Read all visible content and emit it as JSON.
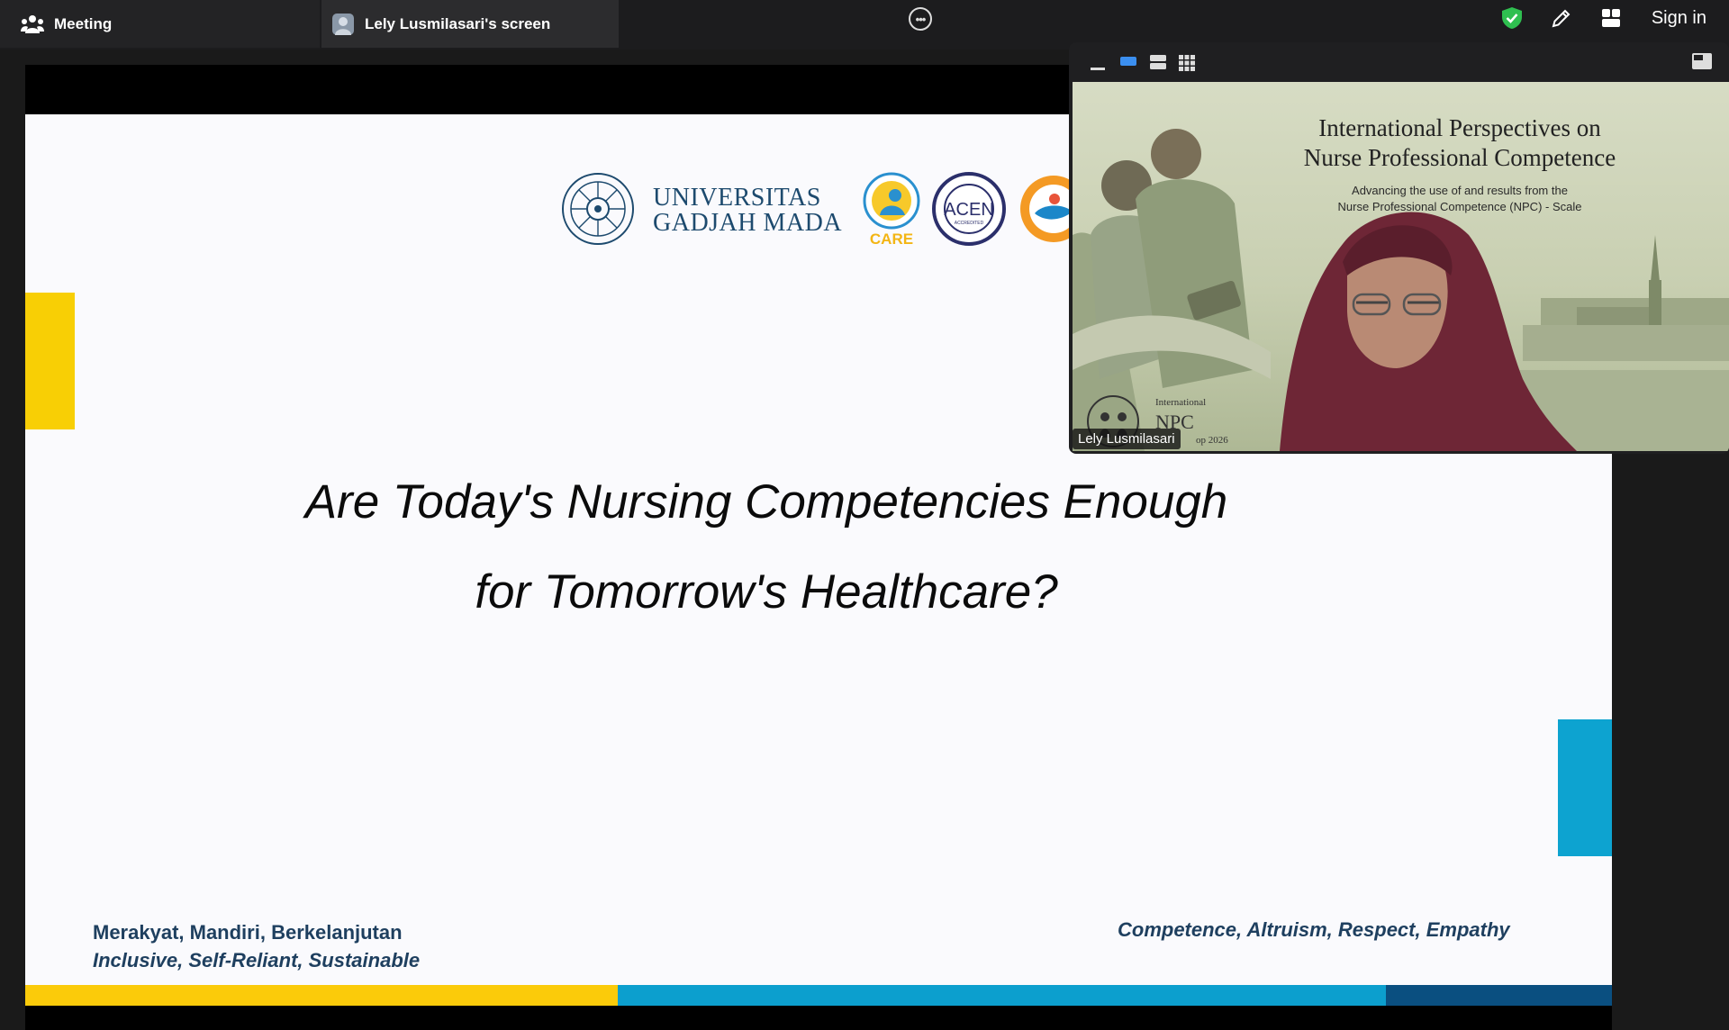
{
  "top_bar": {
    "meeting_tab_label": "Meeting",
    "screen_tab_label": "Lely Lusmilasari's screen",
    "sign_in_label": "Sign in",
    "icons": [
      "people-icon",
      "avatar-icon",
      "more-options-icon",
      "shield-check-icon",
      "pencil-icon",
      "grid-view-icon"
    ],
    "accent_color": "#1a73e8",
    "shield_color": "#2fbf50"
  },
  "slide": {
    "university_line1": "UNIVERSITAS",
    "university_line2": "GADJAH MADA",
    "care_logo_text": "CARE",
    "acen_logo_text": "ACEN",
    "acen_sub_text": "ACCREDITED",
    "headline_line1": "Are Today's Nursing Competencies Enough",
    "headline_line2": "for Tomorrow's Healthcare?",
    "motto_left_line1": "Merakyat, Mandiri, Berkelanjutan",
    "motto_left_line2": "Inclusive, Self-Reliant, Sustainable",
    "motto_right": "Competence, Altruism, Respect, Empathy",
    "colors": {
      "yellow": "#f8cf05",
      "blue": "#0da3d0",
      "dark_blue": "#0a4f80",
      "text_navy": "#1e3f5f"
    }
  },
  "video_panel": {
    "background_title_line1": "International Perspectives on",
    "background_title_line2": "Nurse Professional Competence",
    "background_subtitle_line1": "Advancing the use of and results from the",
    "background_subtitle_line2": "Nurse Professional Competence (NPC) - Scale",
    "npc_label_small": "International",
    "npc_label_big": "NPC",
    "npc_label_year": "op 2026",
    "participant_name": "Lely Lusmilasari"
  }
}
